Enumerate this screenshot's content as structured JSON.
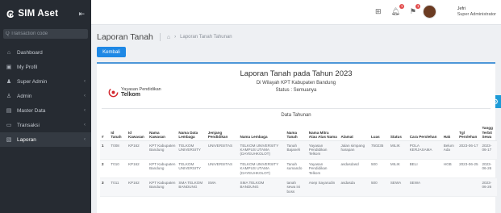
{
  "app": {
    "logo": "₢",
    "name": "SIM Aset",
    "pin_icon": "pin-icon"
  },
  "sidebar": {
    "search_placeholder": "Q Transaction code",
    "items": [
      {
        "label": "Dashboard",
        "icon": "⌂",
        "chevron": ""
      },
      {
        "label": "My Profil",
        "icon": "▣",
        "chevron": ""
      },
      {
        "label": "Super Admin",
        "icon": "♟",
        "chevron": "‹"
      },
      {
        "label": "Admin",
        "icon": "♙",
        "chevron": "‹"
      },
      {
        "label": "Master Data",
        "icon": "▤",
        "chevron": "‹"
      },
      {
        "label": "Transaksi",
        "icon": "▭",
        "chevron": "‹"
      },
      {
        "label": "Laporan",
        "icon": "▧",
        "chevron": "‹"
      }
    ]
  },
  "topbar": {
    "grid_icon": "⊞",
    "bell_badge": "1",
    "alert_badge": "1",
    "user_name": "Jefri",
    "user_role": "Super Administrator"
  },
  "page": {
    "title": "Laporan Tanah",
    "breadcrumb": "Laporan Tanah Tahunan",
    "back_button": "Kembali"
  },
  "report": {
    "logo_small": "Yayasan Pendidikan",
    "logo_big": "Telkom",
    "title": "Laporan Tanah pada Tahun 2023",
    "subtitle": "Di Wilayah KPT Kabupaten Bandung",
    "status_line": "Status : Semuanya",
    "table_caption": "Data Tahunan",
    "columns": [
      "#",
      "Id Tanah",
      "Id Kawasan",
      "Nama Kawasan",
      "Nama Data Lembaga",
      "Jenjang Pendidikan",
      "Nama Lembaga",
      "Nama Tanah",
      "Nama Mitra Atau Atas Nama",
      "Alamat",
      "Luas",
      "Status",
      "Cara Perolehan",
      "Hak",
      "Tgl Perolehan",
      "Tangg Terbit Sewa"
    ],
    "rows": [
      [
        "1",
        "T008",
        "KP162",
        "KPT Kabupaten Bandung",
        "TELKOM UNIVERSITY",
        "UNIVERSITAS",
        "TELKOM UNIVERSITY KAMPUS UTAMA (DAYEUHKOLOT)",
        "Tanah Bajaneh",
        "Yayasan Pendidikan Telkom",
        "Jalan simpang harapan",
        "750235",
        "MILIK",
        "POLA KERJASAMA",
        "Belum Ada",
        "2023-06-17",
        "2023-06-17"
      ],
      [
        "2",
        "T010",
        "KP162",
        "KPT Kabupaten Bandung",
        "TELKOM UNIVERSITY",
        "UNIVERSITAS",
        "TELKOM UNIVERSITY KAMPUS UTAMA (DAYEUHKOLOT)",
        "Tanah sumando",
        "Yayasan Pendidikan Telkom",
        "asdasdasd",
        "500",
        "MILIK",
        "BELI",
        "HGB",
        "2023-06-25",
        "2023-06-26"
      ],
      [
        "3",
        "T011",
        "KP162",
        "KPT Kabupaten Bandung",
        "SMA TELKOM BANDUNG",
        "SMA",
        "SMA TELKOM BANDUNG",
        "tanah sewa ini boss",
        "Asep Sayarudin",
        "asdasda",
        "500",
        "SEWA",
        "SEWA",
        "",
        "",
        "2023-06-26"
      ]
    ]
  },
  "colors": {
    "sidebar_bg": "#262b32",
    "primary": "#1e88e5",
    "accent_blue": "#1d9bd7"
  }
}
